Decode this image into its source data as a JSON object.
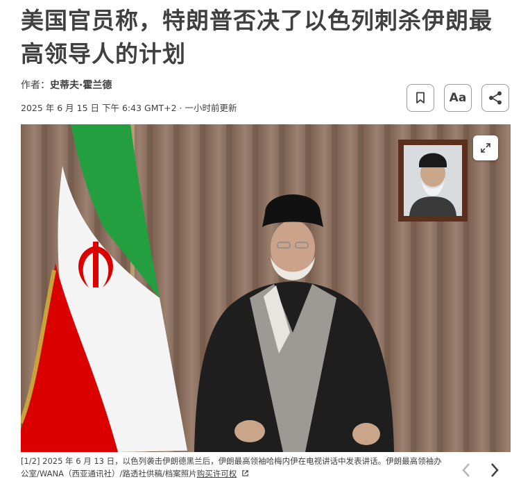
{
  "article": {
    "headline": "美国官员称，特朗普否决了以色列刺杀伊朗最高领导人的计划",
    "author_prefix": "作者：",
    "author": "史蒂夫·霍兰德",
    "dateline": "2025 年 6 月 15 日 下午 6:43 GMT+2 · 一小时前更新"
  },
  "toolbar": {
    "bookmark_icon": "bookmark-icon",
    "text_size_label": "Aa",
    "share_icon": "share-icon"
  },
  "gallery": {
    "index_label": "[1/2]",
    "caption": " 2025 年 6 月 13 日，以色列袭击伊朗德黑兰后，伊朗最高领袖哈梅内伊在电视讲话中发表讲话。伊朗最高领袖办公室/WANA（西亚通讯社）/路透社供稿/档案照片",
    "license_link": "购买许可权",
    "expand_icon": "expand-icon",
    "prev_icon": "chevron-left-icon",
    "next_icon": "chevron-right-icon"
  },
  "colors": {
    "text": "#404040",
    "flag_green": "#239f40",
    "flag_red": "#da0000",
    "curtain": "#8b6f5e"
  }
}
